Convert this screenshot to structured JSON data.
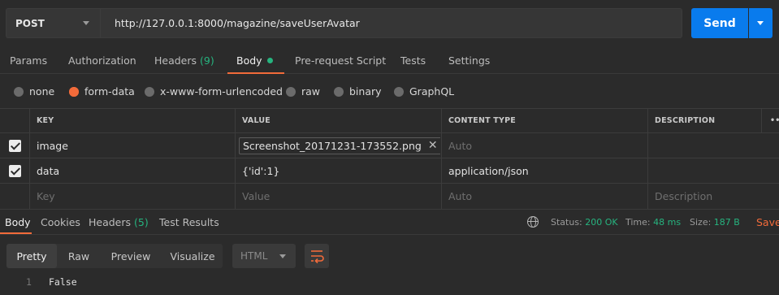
{
  "request": {
    "method": "POST",
    "url": "http://127.0.0.1:8000/magazine/saveUserAvatar",
    "send_label": "Send"
  },
  "request_tabs": [
    {
      "label": "Params"
    },
    {
      "label": "Authorization"
    },
    {
      "label": "Headers",
      "count": "(9)"
    },
    {
      "label": "Body"
    },
    {
      "label": "Pre-request Script"
    },
    {
      "label": "Tests"
    },
    {
      "label": "Settings"
    }
  ],
  "body_types": [
    "none",
    "form-data",
    "x-www-form-urlencoded",
    "raw",
    "binary",
    "GraphQL"
  ],
  "body_type_selected": "form-data",
  "table": {
    "headers": [
      "KEY",
      "VALUE",
      "CONTENT TYPE",
      "DESCRIPTION"
    ],
    "rows": [
      {
        "checked": true,
        "key": "image",
        "value": "Screenshot_20171231-173552.png",
        "content_type_placeholder": "Auto",
        "description": ""
      },
      {
        "checked": true,
        "key": "data",
        "value": "{'id':1}",
        "content_type": "application/json",
        "description": ""
      }
    ],
    "new_row": {
      "key_placeholder": "Key",
      "value_placeholder": "Value",
      "content_type_placeholder": "Auto",
      "description_placeholder": "Description"
    }
  },
  "response": {
    "tabs": [
      {
        "label": "Body"
      },
      {
        "label": "Cookies"
      },
      {
        "label": "Headers",
        "count": "(5)"
      },
      {
        "label": "Test Results"
      }
    ],
    "status_label": "Status:",
    "status_value": "200 OK",
    "time_label": "Time:",
    "time_value": "48 ms",
    "size_label": "Size:",
    "size_value": "187 B",
    "save_label": "Save"
  },
  "view": {
    "modes": [
      "Pretty",
      "Raw",
      "Preview",
      "Visualize"
    ],
    "active_mode": "Pretty",
    "format": "HTML"
  },
  "output": {
    "line_number": "1",
    "text": "False"
  },
  "colors": {
    "accent": "#f26b3a",
    "send": "#097bed",
    "success": "#26b47f",
    "background": "#2b2b2b"
  },
  "icons": [
    "chevron-down-icon",
    "checkbox-checked-icon",
    "close-icon",
    "globe-icon",
    "wrap-lines-icon",
    "more-icon"
  ]
}
